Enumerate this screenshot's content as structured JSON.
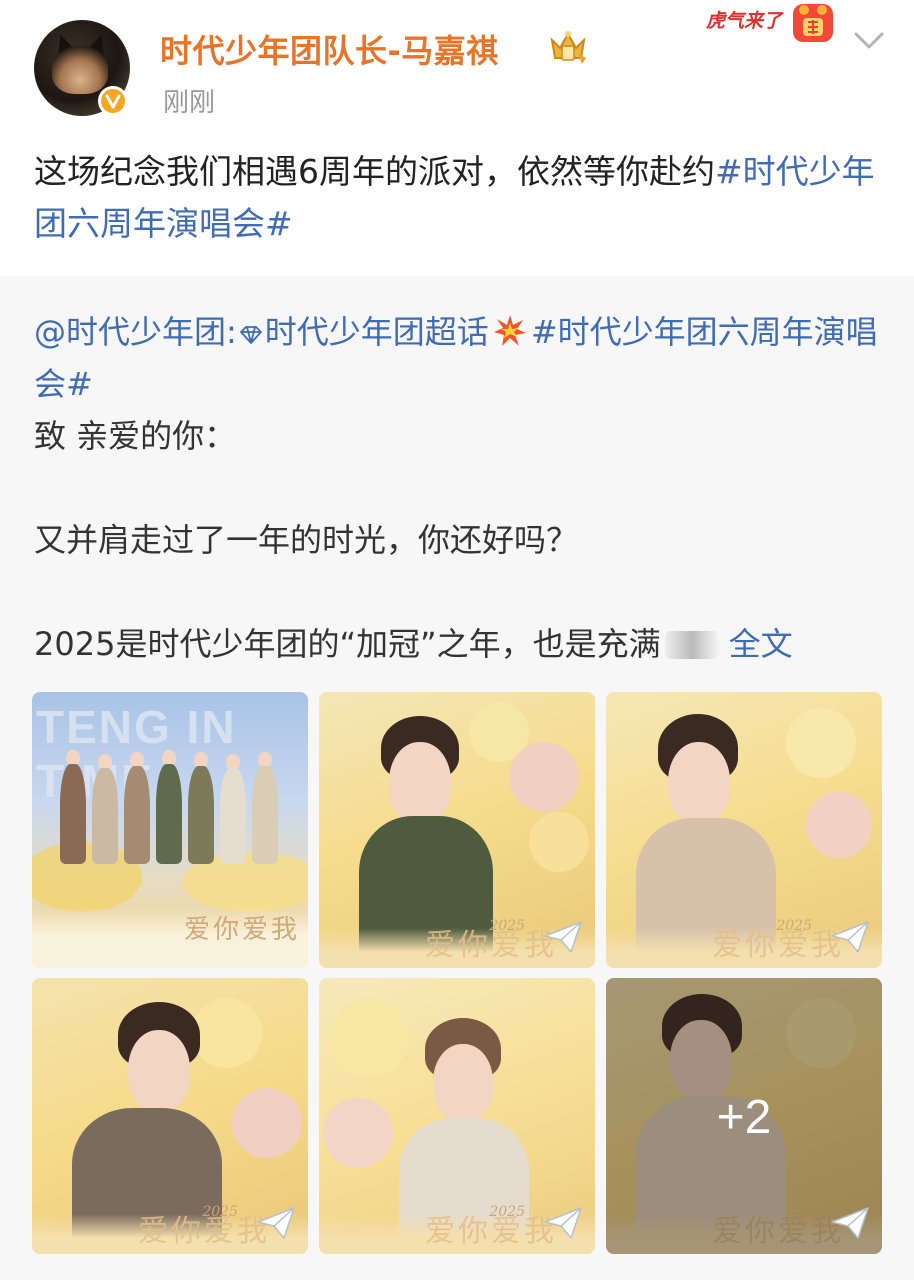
{
  "author": {
    "name": "时代少年团队长-马嘉祺",
    "timestamp": "刚刚",
    "badge_icon": "crown-icon",
    "verified_color": "#f5a623"
  },
  "sticker": {
    "text": "虎气来了",
    "icon": "paw-icon"
  },
  "post": {
    "text_part1": "这场纪念我们相遇6周年的派对，依然等你赴约",
    "hashtag": "#时代少年团六周年演唱会#"
  },
  "repost": {
    "mention": "@时代少年团:",
    "supertopic": "时代少年团超话",
    "hashtag": "#时代少年团六周年演唱会#",
    "greeting": "致 亲爱的你：",
    "line2": "又并肩走过了一年的时光，你还好吗？",
    "line3": "2025是时代少年团的“加冠”之年，也是充满",
    "more": "全文"
  },
  "images": {
    "group_title": "TENG IN TIME",
    "caption": "爱你爱我",
    "year": "2025",
    "more_count": "+2"
  },
  "colors": {
    "username": "#e8742a",
    "link": "#3f6cb4",
    "repost_bg": "#f7f7f7"
  }
}
